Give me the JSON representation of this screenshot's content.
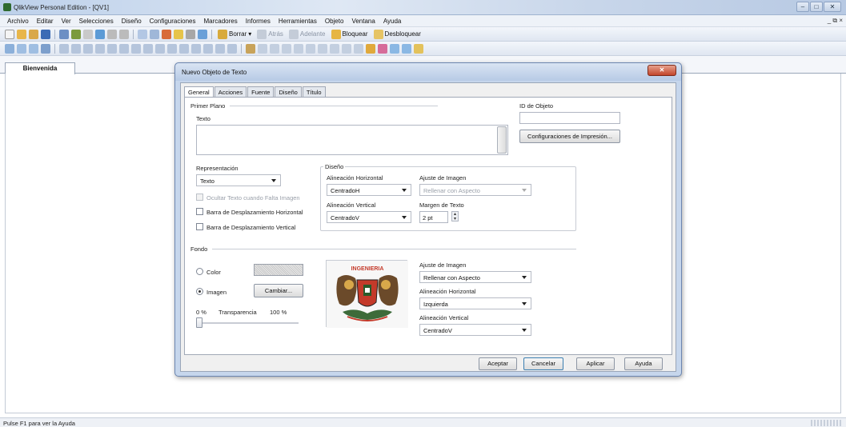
{
  "app": {
    "title": "QlikView Personal Edition - [QV1]",
    "window_buttons": [
      "–",
      "□",
      "✕"
    ],
    "mdi_buttons": "_ ⧉ ×"
  },
  "menu": [
    "Archivo",
    "Editar",
    "Ver",
    "Selecciones",
    "Diseño",
    "Configuraciones",
    "Marcadores",
    "Informes",
    "Herramientas",
    "Objeto",
    "Ventana",
    "Ayuda"
  ],
  "toolbar": {
    "borrar": "Borrar",
    "atras": "Atrás",
    "adelante": "Adelante",
    "bloquear": "Bloquear",
    "desbloquear": "Desbloquear"
  },
  "sheet": {
    "tab_label": "Bienvenida"
  },
  "status": {
    "text": "Pulse F1 para ver la Ayuda"
  },
  "dialog": {
    "title": "Nuevo Objeto de Texto",
    "close": "✕",
    "tabs": [
      "General",
      "Acciones",
      "Fuente",
      "Diseño",
      "Título"
    ],
    "primer_plano": "Primer Plano",
    "texto_label": "Texto",
    "texto_value": "",
    "id_objeto_label": "ID de Objeto",
    "id_objeto_value": "",
    "config_impresion": "Configuraciones de Impresión...",
    "representacion_label": "Representación",
    "representacion_value": "Texto",
    "ocultar_texto": "Ocultar Texto cuando Falta Imagen",
    "barra_horizontal": "Barra de Desplazamiento Horizontal",
    "barra_vertical": "Barra de Desplazamiento Vertical",
    "diseno_label": "Diseño",
    "alin_horizontal_label": "Alineación Horizontal",
    "alin_horizontal_value": "CentradoH",
    "ajuste_imagen_label": "Ajuste de Imagen",
    "ajuste_imagen_value": "Rellenar con Aspecto",
    "alin_vertical_label": "Alineación Vertical",
    "alin_vertical_value": "CentradoV",
    "margen_label": "Margen de Texto",
    "margen_value": "2 pt",
    "fondo_label": "Fondo",
    "color_label": "Color",
    "imagen_label": "Imagen",
    "cambiar": "Cambiar...",
    "transp_min": "0 %",
    "transp_label": "Transparencia",
    "transp_max": "100 %",
    "transparency_level": 0,
    "bg_ajuste_label": "Ajuste de Imagen",
    "bg_ajuste_value": "Rellenar con Aspecto",
    "bg_alin_h_label": "Alineación Horizontal",
    "bg_alin_h_value": "Izquierda",
    "bg_alin_v_label": "Alineación Vertical",
    "bg_alin_v_value": "CentradoV",
    "logo_text": "INGENIERIA",
    "buttons": {
      "aceptar": "Aceptar",
      "cancelar": "Cancelar",
      "aplicar": "Aplicar",
      "ayuda": "Ayuda"
    }
  }
}
